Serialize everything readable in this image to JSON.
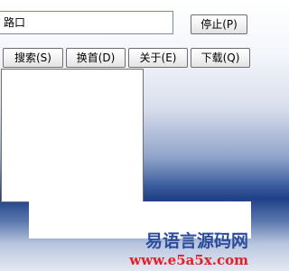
{
  "input": {
    "value": "路口"
  },
  "buttons": {
    "stop": "停止(P)",
    "search": "搜索(S)",
    "switch_first": "换首(D)",
    "about": "关于(E)",
    "download": "下载(Q)"
  },
  "watermark": {
    "title": "易语言源码网",
    "url": "www.e5a5x.com"
  },
  "colors": {
    "watermark_title": "#2d4d9c",
    "watermark_url": "#e0202a",
    "background_dark": "#1f4087"
  }
}
